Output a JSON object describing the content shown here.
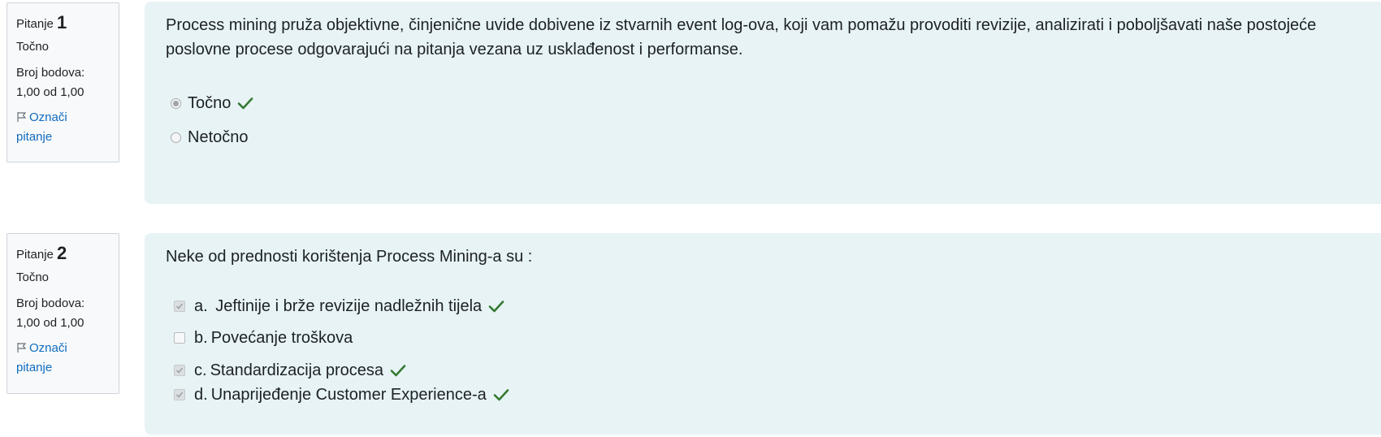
{
  "questions": [
    {
      "label": "Pitanje",
      "number": "1",
      "state": "Točno",
      "grade_label": "Broj bodova:",
      "grade_value": "1,00 od 1,00",
      "flag_line1": "Označi",
      "flag_line2": "pitanje",
      "text": "Process mining pruža objektivne, činjenične uvide dobivene iz stvarnih event log-ova, koji vam pomažu provoditi revizije, analizirati i poboljšavati naše postojeće poslovne procese odgovarajući na pitanja vezana uz usklađenost i performanse.",
      "answers": [
        {
          "label": "Točno",
          "selected": true,
          "correct": true
        },
        {
          "label": "Netočno",
          "selected": false,
          "correct": false
        }
      ]
    },
    {
      "label": "Pitanje",
      "number": "2",
      "state": "Točno",
      "grade_label": "Broj bodova:",
      "grade_value": "1,00 od 1,00",
      "flag_line1": "Označi",
      "flag_line2": "pitanje",
      "text": "Neke od prednosti korištenja Process Mining-a su :",
      "answers": [
        {
          "letter": "a.",
          "label": " Jeftinije i brže revizije nadležnih tijela",
          "selected": true,
          "correct": true
        },
        {
          "letter": "b.",
          "label": "Povećanje troškova",
          "selected": false,
          "correct": false
        },
        {
          "letter": "c.",
          "label": "Standardizacija procesa",
          "selected": true,
          "correct": true
        },
        {
          "letter": "d.",
          "label": "Unaprijeđenje Customer Experience-a",
          "selected": true,
          "correct": true
        }
      ]
    }
  ],
  "colors": {
    "accent": "#0f6cbf",
    "correct": "#357a32",
    "content_bg": "#e7f3f5",
    "info_bg": "#f8f9fa"
  }
}
